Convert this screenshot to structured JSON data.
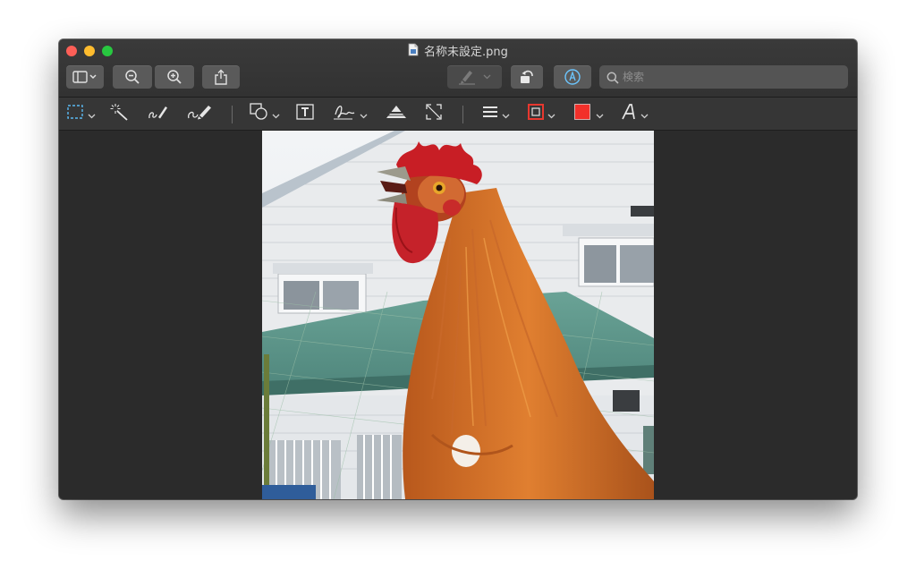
{
  "window": {
    "title": "名称未設定.png"
  },
  "search": {
    "placeholder": "検索"
  },
  "icons": {
    "sidebar": "sidebar-icon",
    "zoom_out": "zoom-out-icon",
    "zoom_in": "zoom-in-icon",
    "share": "share-icon",
    "highlight": "highlighter-icon",
    "rotate": "rotate-left-icon",
    "markup": "markup-icon",
    "search": "search-icon"
  },
  "markup_tools": [
    "rectangular-selection-icon",
    "instant-alpha-icon",
    "sketch-icon",
    "draw-icon",
    "shapes-icon",
    "text-icon",
    "sign-icon",
    "adjust-color-icon",
    "adjust-size-icon",
    "shape-style-icon",
    "border-color-icon",
    "fill-color-icon",
    "text-style-icon"
  ],
  "colors": {
    "border_color": "#e8382f",
    "fill_color": "#f2302a",
    "markup_accent": "#6cc6ff",
    "selection_accent": "#5ab8f0"
  }
}
